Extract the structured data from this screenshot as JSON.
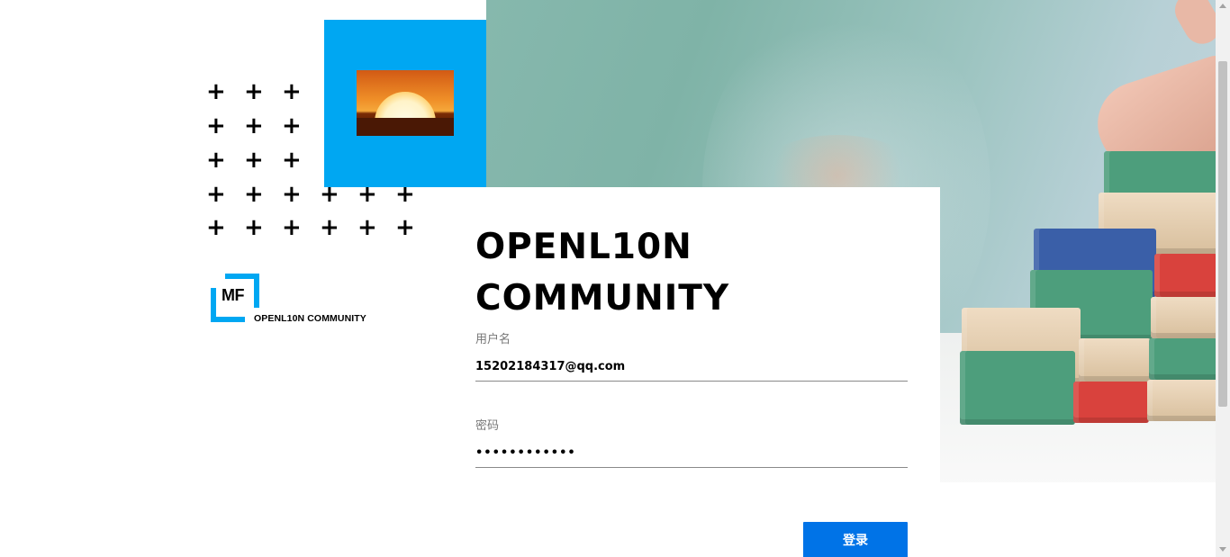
{
  "brand": {
    "logo_mark": "MF",
    "logo_text": "OPENL10N COMMUNITY",
    "accent_color": "#00a7f2"
  },
  "login": {
    "title": "OPENL10N COMMUNITY",
    "username_label": "用户名",
    "username_value": "15202184317@qq.com",
    "password_label": "密码",
    "password_value": "••••••••••••",
    "submit_label": "登录",
    "button_color": "#0073e7"
  },
  "decor": {
    "plus_glyph": "+",
    "hero_image": "wooden-blocks-stairs-photo",
    "thumbnail_image": "sunset-photo"
  }
}
